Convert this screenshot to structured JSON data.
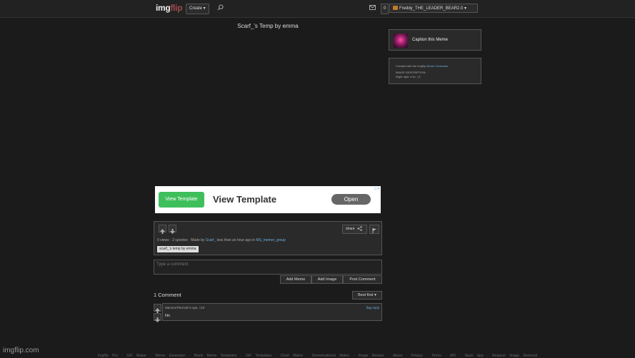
{
  "header": {
    "logo_main": "img",
    "logo_accent": "flip",
    "create_label": "Create ▾",
    "notif_count": "0",
    "username": "Freddy_THE_LEADER_BEAR2.0 ▾"
  },
  "meme": {
    "title": "Scarf_'s Temp by emma"
  },
  "sidebar": {
    "caption_label": "Caption this Meme",
    "created_with": "Created with the Imgflip",
    "generator_link": "Meme Generator",
    "image_desc_label": "IMAGE DESCRIPTION:",
    "image_desc": "Right right, it is!. <3"
  },
  "ad": {
    "badge": "▷✕",
    "logo_text": "View Template",
    "title": "View Template",
    "cta": "Open"
  },
  "info": {
    "share_label": "share",
    "stats": "0 views · 2 upvotes · Made by",
    "author": "Scarf_",
    "time_text": "less than an hour ago in",
    "stream": "MS_memer_group",
    "tag": "scarf_'s temp by emma"
  },
  "comment_form": {
    "placeholder": "Type a comment",
    "add_meme": "Add Meme",
    "add_image": "Add Image",
    "post": "Post Comment"
  },
  "comments": {
    "count_label": "1 Comment",
    "sort_label": "Best first ▾",
    "items": [
      {
        "header": "MarionsTheCult!  0 ups, <1h",
        "text": "Nn",
        "actions": "flag  reply"
      }
    ]
  },
  "footer": {
    "logo": "imgflip.com",
    "links": "Imgflip Pro · GIF Maker · Meme Generator · Blank Meme Templates · GIF Templates · Chart Maker · Demotivational Maker · Image Resizer · About · Privacy · Terms · API · Slack App · Request Image Removal"
  },
  "colors": {
    "background": "#1b1b1b",
    "link": "#6ab0e0",
    "ad_green": "#3fbf5c"
  }
}
